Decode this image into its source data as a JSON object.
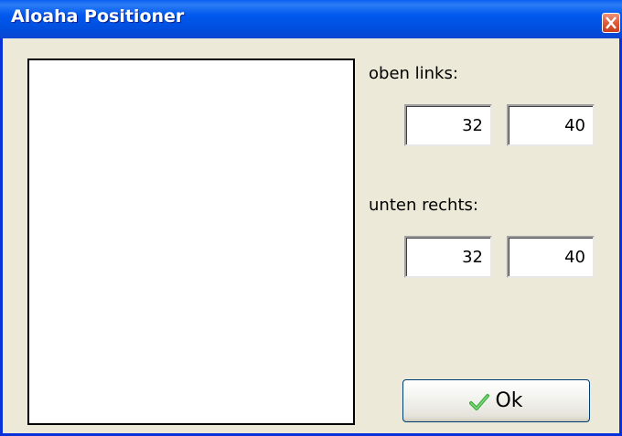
{
  "window": {
    "title": "Aloaha Positioner"
  },
  "top_left": {
    "label": "oben links:",
    "x": "32",
    "y": "40"
  },
  "bottom_right": {
    "label": "unten rechts:",
    "x": "32",
    "y": "40"
  },
  "ok_button": {
    "label": "Ok"
  },
  "icons": {
    "close": "close-icon",
    "ok": "checkmark-icon"
  },
  "colors": {
    "titlebar": "#0058ee",
    "window_bg": "#ece9d8",
    "close_button": "#e05a38",
    "checkmark": "#3cae3c"
  }
}
